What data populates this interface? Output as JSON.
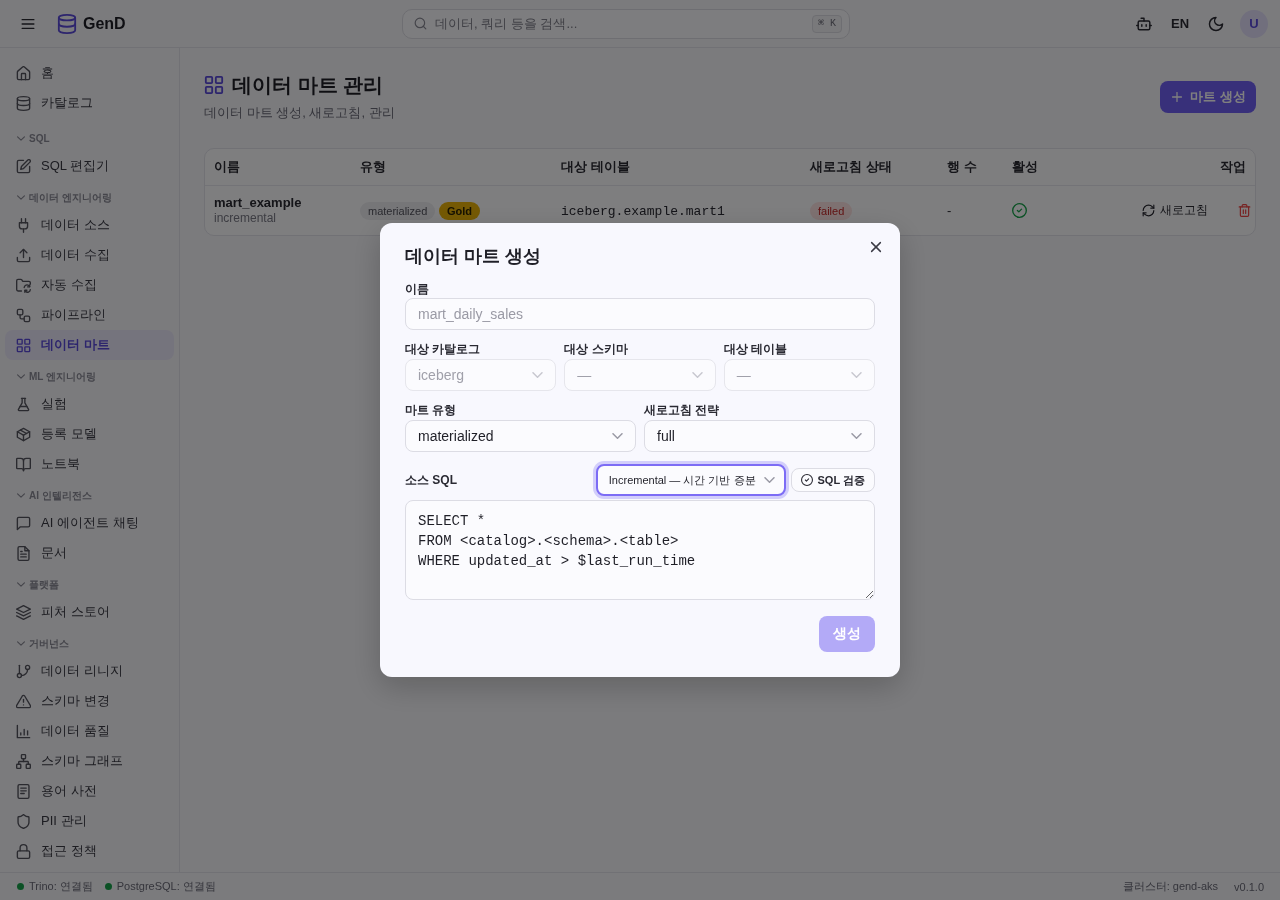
{
  "header": {
    "brand": "GenD",
    "search": {
      "placeholder": "데이터, 쿼리 등을 검색...",
      "shortcut": "⌘ K"
    },
    "language": "EN",
    "avatar": "U"
  },
  "sidebar": {
    "groups": [
      {
        "items": [
          {
            "label": "홈",
            "selected": false
          },
          {
            "label": "카탈로그",
            "selected": false
          }
        ]
      },
      {
        "title": "SQL",
        "expanded": true,
        "items": [
          {
            "label": "SQL 편집기",
            "selected": false
          }
        ]
      },
      {
        "title": "데이터 엔지니어링",
        "expanded": true,
        "items": [
          {
            "label": "데이터 소스",
            "selected": false
          },
          {
            "label": "데이터 수집",
            "selected": false
          },
          {
            "label": "자동 수집",
            "selected": false
          },
          {
            "label": "파이프라인",
            "selected": false
          },
          {
            "label": "데이터 마트",
            "selected": true
          }
        ]
      },
      {
        "title": "ML 엔지니어링",
        "expanded": true,
        "items": [
          {
            "label": "실험",
            "selected": false
          },
          {
            "label": "등록 모델",
            "selected": false
          },
          {
            "label": "노트북",
            "selected": false
          }
        ]
      },
      {
        "title": "AI 인텔리전스",
        "expanded": true,
        "items": [
          {
            "label": "AI 에이전트 채팅",
            "selected": false
          },
          {
            "label": "문서",
            "selected": false
          }
        ]
      },
      {
        "title": "플랫폼",
        "expanded": true,
        "items": [
          {
            "label": "피처 스토어",
            "selected": false
          }
        ]
      },
      {
        "title": "거버넌스",
        "expanded": true,
        "items": [
          {
            "label": "데이터 리니지",
            "selected": false
          },
          {
            "label": "스키마 변경",
            "selected": false
          },
          {
            "label": "데이터 품질",
            "selected": false
          },
          {
            "label": "스키마 그래프",
            "selected": false
          },
          {
            "label": "용어 사전",
            "selected": false
          },
          {
            "label": "PII 관리",
            "selected": false
          },
          {
            "label": "접근 정책",
            "selected": false
          }
        ]
      }
    ]
  },
  "page": {
    "title": "데이터 마트 관리",
    "subtitle": "데이터 마트 생성, 새로고침, 관리",
    "create_button": "마트 생성"
  },
  "table": {
    "columns": [
      "이름",
      "유형",
      "대상 테이블",
      "새로고침 상태",
      "행 수",
      "활성",
      "작업"
    ],
    "rows": [
      {
        "name": "mart_example",
        "strategy": "incremental",
        "type": "materialized",
        "tier": {
          "label": "Gold",
          "kind": "gold"
        },
        "target": "iceberg.example.mart1",
        "status": {
          "label": "failed",
          "kind": "error"
        },
        "row_count": "-",
        "active": true,
        "refresh_button": "새로고침"
      }
    ]
  },
  "dialog": {
    "title": "데이터 마트 생성",
    "name": {
      "label": "이름",
      "placeholder": "mart_daily_sales"
    },
    "targets": [
      {
        "label": "대상 카탈로그",
        "value": "iceberg",
        "disabled": true
      },
      {
        "label": "대상 스키마",
        "value": "—",
        "disabled": true
      },
      {
        "label": "대상 테이블",
        "value": "—",
        "disabled": true
      }
    ],
    "options": [
      {
        "label": "마트 유형",
        "value": "materialized",
        "disabled": false
      },
      {
        "label": "새로고침 전략",
        "value": "full",
        "disabled": false
      }
    ],
    "sql": {
      "label": "소스 SQL",
      "template": {
        "value": "Incremental — 시간 기반 증분",
        "focused": true
      },
      "validate_button": "SQL 검증",
      "value": "SELECT *\nFROM <catalog>.<schema>.<table>\nWHERE updated_at > $last_run_time"
    },
    "submit": {
      "label": "생성",
      "disabled": true
    }
  },
  "status_bar": {
    "connections": [
      {
        "label": "Trino: 연결됨",
        "connected": true
      },
      {
        "label": "PostgreSQL: 연결됨",
        "connected": true
      }
    ],
    "cluster": "클러스터: gend-aks",
    "version": "v0.1.0"
  }
}
